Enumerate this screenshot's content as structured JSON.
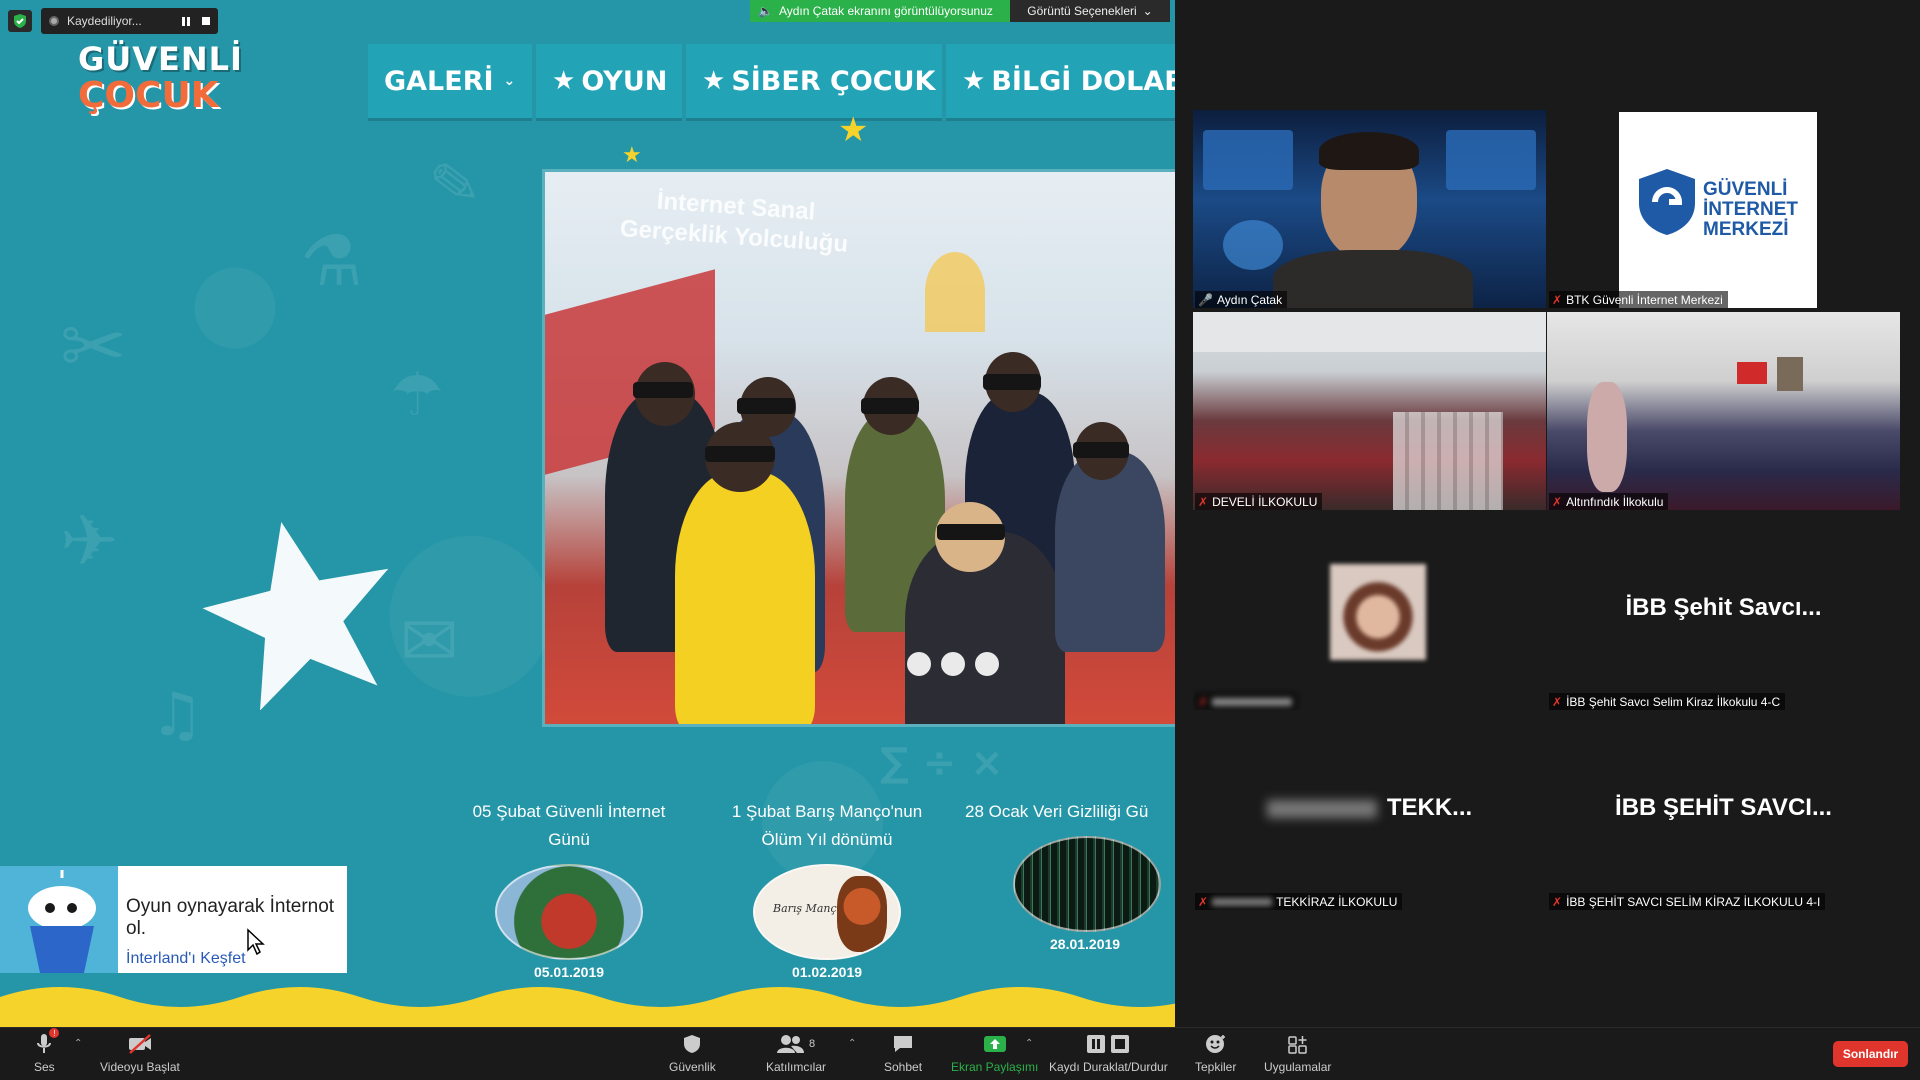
{
  "recording": {
    "label": "Kaydediliyor..."
  },
  "share_banner": {
    "viewing_text": "Aydın Çatak ekranını görüntülüyorsunuz",
    "options_label": "Görüntü Seçenekleri"
  },
  "site": {
    "logo_top": "GÜVENLİ",
    "logo_bottom": "ÇOCUK",
    "nav": [
      {
        "label": "GALERİ",
        "icon": "chevron-down-icon"
      },
      {
        "label": "OYUN",
        "icon": "star-icon"
      },
      {
        "label": "SİBER ÇOCUK",
        "icon": "star-icon"
      },
      {
        "label": "BİLGİ DOLABI",
        "icon": "star-icon"
      }
    ],
    "slide": {
      "title": "İnternet Sanal Gerçeklik Yolculuğu"
    },
    "news": [
      {
        "title": "05 Şubat Güvenli İnternet Günü",
        "date": "05.01.2019"
      },
      {
        "title": "1 Şubat Barış Manço'nun Ölüm Yıl dönümü",
        "date": "01.02.2019",
        "img_text": "Barış Manço"
      },
      {
        "title": "28 Ocak Veri Gizliliği Gü",
        "date": "28.01.2019"
      }
    ],
    "promo": {
      "line1": "Oyun oynayarak İnternot ol.",
      "link": "İnterland'ı Keşfet"
    }
  },
  "gallery": [
    {
      "name": "Aydın Çatak",
      "active": true
    },
    {
      "name": "BTK Güvenli İnternet Merkezi",
      "logo_line1": "GÜVENLİ",
      "logo_line2": "İNTERNET",
      "logo_line3": "MERKEZİ"
    },
    {
      "name": "DEVELİ İLKOKULU"
    },
    {
      "name": "Altınfındık İlkokulu"
    },
    {
      "name": "",
      "note": "blurred name"
    },
    {
      "name": "İBB Şehit Savcı Selim Kiraz İlkokulu 4-C",
      "big": "İBB Şehit Savcı..."
    },
    {
      "name": "TEKKİRAZ İLKOKULU",
      "big": "TEKK..."
    },
    {
      "name": "İBB ŞEHİT SAVCI SELİM KİRAZ İLKOKULU 4-I",
      "big": "İBB ŞEHİT SAVCI..."
    }
  ],
  "toolbar": {
    "audio": "Ses",
    "video": "Videoyu Başlat",
    "security": "Güvenlik",
    "participants": "Katılımcılar",
    "participant_count": "8",
    "chat": "Sohbet",
    "share": "Ekran Paylaşımı",
    "record": "Kaydı Duraklat/Durdur",
    "reactions": "Tepkiler",
    "apps": "Uygulamalar",
    "end": "Sonlandır"
  },
  "colors": {
    "site_bg": "#2596a7",
    "nav_bg": "#22a4b6",
    "share_green": "#2bb14a",
    "end_red": "#e0352c",
    "active_speaker": "#f0e24a"
  }
}
